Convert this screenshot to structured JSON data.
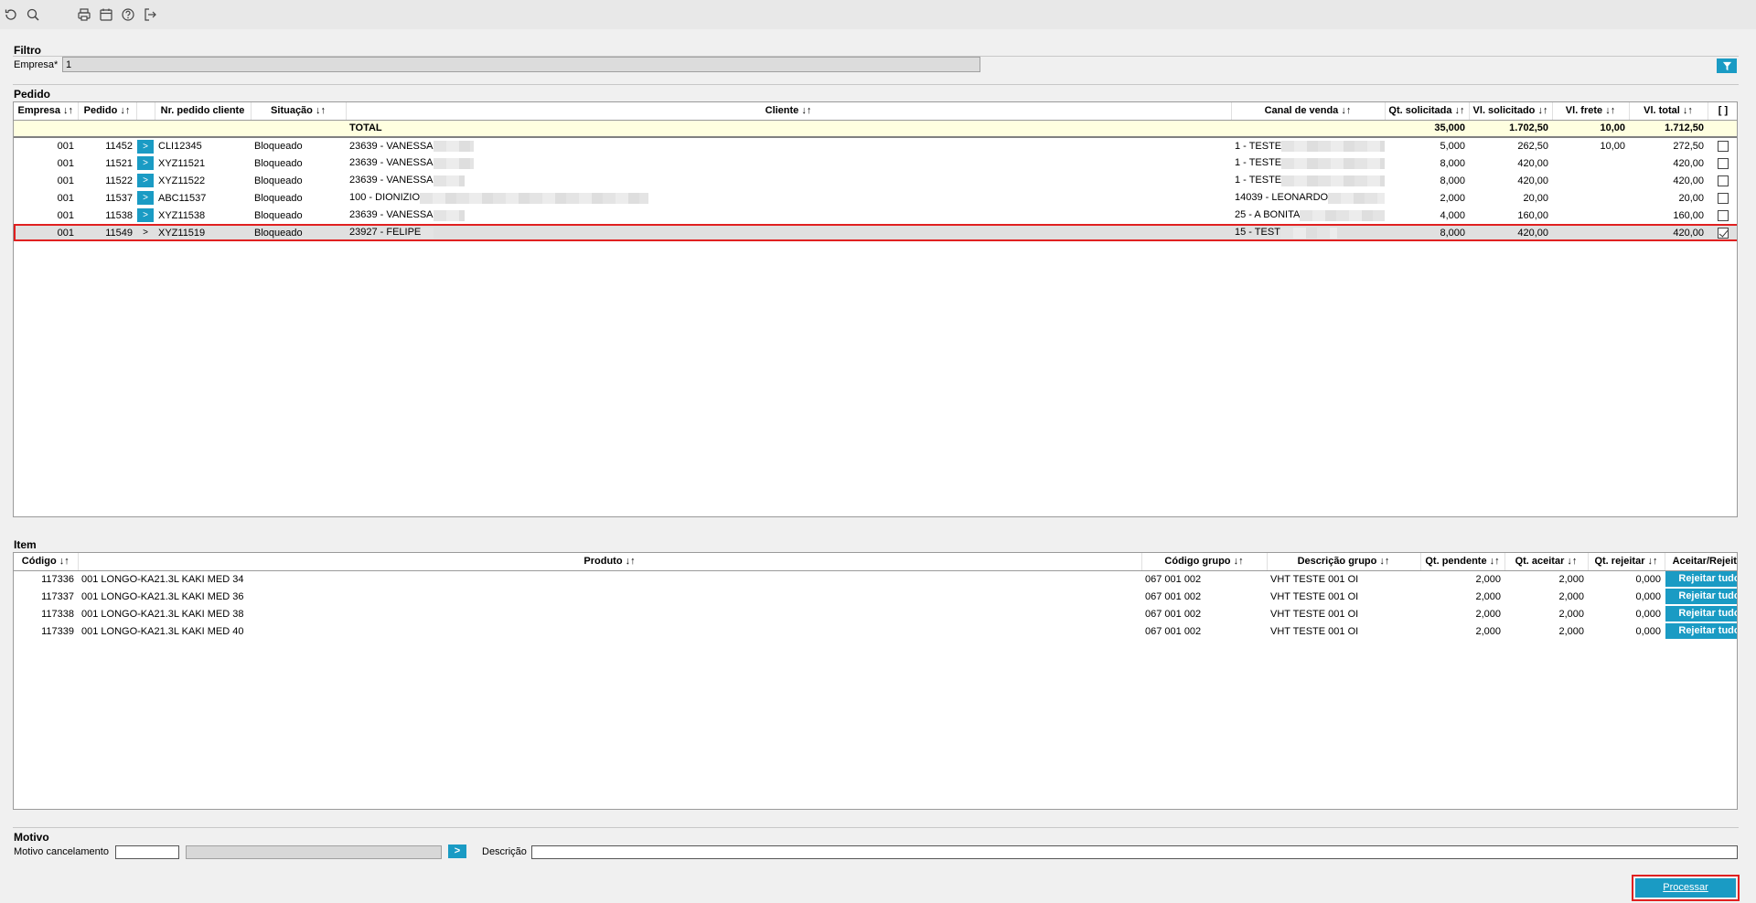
{
  "toolbar": {
    "icons": [
      "refresh-icon",
      "search-icon",
      "print-icon",
      "calendar-icon",
      "help-icon",
      "exit-icon"
    ]
  },
  "filtro": {
    "title": "Filtro",
    "empresa_label": "Empresa*",
    "empresa_value": "1"
  },
  "pedido": {
    "title": "Pedido",
    "columns": [
      "Empresa ↓↑",
      "Pedido ↓↑",
      "",
      "Nr. pedido cliente",
      "Situação ↓↑",
      "Cliente ↓↑",
      "Canal de venda ↓↑",
      "Qt. solicitada ↓↑",
      "Vl. solicitado ↓↑",
      "Vl. frete ↓↑",
      "Vl. total ↓↑",
      "[ ]"
    ],
    "total": {
      "label": "TOTAL",
      "qt_solicitada": "35,000",
      "vl_solicitado": "1.702,50",
      "vl_frete": "10,00",
      "vl_total": "1.712,50"
    },
    "rows": [
      {
        "empresa": "001",
        "pedido": "11452",
        "go": ">",
        "nr_cliente": "CLI12345",
        "situacao": "Bloqueado",
        "cliente": "23639 - VANESSA",
        "canal": "1 - TESTE",
        "qt": "5,000",
        "vl_sol": "262,50",
        "frete": "10,00",
        "total": "272,50",
        "checked": false
      },
      {
        "empresa": "001",
        "pedido": "11521",
        "go": ">",
        "nr_cliente": "XYZ11521",
        "situacao": "Bloqueado",
        "cliente": "23639 - VANESSA",
        "canal": "1 - TESTE",
        "qt": "8,000",
        "vl_sol": "420,00",
        "frete": "",
        "total": "420,00",
        "checked": false
      },
      {
        "empresa": "001",
        "pedido": "11522",
        "go": ">",
        "nr_cliente": "XYZ11522",
        "situacao": "Bloqueado",
        "cliente": "23639 - VANESSA",
        "canal": "1 - TESTE",
        "qt": "8,000",
        "vl_sol": "420,00",
        "frete": "",
        "total": "420,00",
        "checked": false
      },
      {
        "empresa": "001",
        "pedido": "11537",
        "go": ">",
        "nr_cliente": "ABC11537",
        "situacao": "Bloqueado",
        "cliente": "100 - DIONIZIO",
        "canal": "14039 - LEONARDO",
        "qt": "2,000",
        "vl_sol": "20,00",
        "frete": "",
        "total": "20,00",
        "checked": false
      },
      {
        "empresa": "001",
        "pedido": "11538",
        "go": ">",
        "nr_cliente": "XYZ11538",
        "situacao": "Bloqueado",
        "cliente": "23639 - VANESSA",
        "canal": "25 - A BONITA",
        "qt": "4,000",
        "vl_sol": "160,00",
        "frete": "",
        "total": "160,00",
        "checked": false
      },
      {
        "empresa": "001",
        "pedido": "11549",
        "go": ">",
        "nr_cliente": "XYZ11519",
        "situacao": "Bloqueado",
        "cliente": "23927 - FELIPE",
        "canal": "15 - TEST",
        "qt": "8,000",
        "vl_sol": "420,00",
        "frete": "",
        "total": "420,00",
        "checked": true
      }
    ]
  },
  "item": {
    "title": "Item",
    "columns": [
      "Código ↓↑",
      "Produto ↓↑",
      "Código grupo ↓↑",
      "Descrição grupo ↓↑",
      "Qt. pendente ↓↑",
      "Qt. aceitar ↓↑",
      "Qt. rejeitar ↓↑",
      "Aceitar/Rejeitar"
    ],
    "rows": [
      {
        "codigo": "117336",
        "produto": "001 LONGO-KA21.3L KAKI MED 34",
        "cod_grupo": "067 001 002",
        "desc_grupo": "VHT TESTE 001 OI",
        "qt_pend": "2,000",
        "qt_aceitar": "2,000",
        "qt_rejeitar": "0,000",
        "action": "Rejeitar tudo"
      },
      {
        "codigo": "117337",
        "produto": "001 LONGO-KA21.3L KAKI MED 36",
        "cod_grupo": "067 001 002",
        "desc_grupo": "VHT TESTE 001 OI",
        "qt_pend": "2,000",
        "qt_aceitar": "2,000",
        "qt_rejeitar": "0,000",
        "action": "Rejeitar tudo"
      },
      {
        "codigo": "117338",
        "produto": "001 LONGO-KA21.3L KAKI MED 38",
        "cod_grupo": "067 001 002",
        "desc_grupo": "VHT TESTE 001 OI",
        "qt_pend": "2,000",
        "qt_aceitar": "2,000",
        "qt_rejeitar": "0,000",
        "action": "Rejeitar tudo"
      },
      {
        "codigo": "117339",
        "produto": "001 LONGO-KA21.3L KAKI MED 40",
        "cod_grupo": "067 001 002",
        "desc_grupo": "VHT TESTE 001 OI",
        "qt_pend": "2,000",
        "qt_aceitar": "2,000",
        "qt_rejeitar": "0,000",
        "action": "Rejeitar tudo"
      }
    ]
  },
  "motivo": {
    "title": "Motivo",
    "cancel_label": "Motivo cancelamento",
    "go": ">",
    "descricao_label": "Descrição"
  },
  "processar_label": "Processar",
  "colors": {
    "accent": "#1a9bc4",
    "highlight": "#e02020",
    "total_bg": "#ffffe0"
  }
}
